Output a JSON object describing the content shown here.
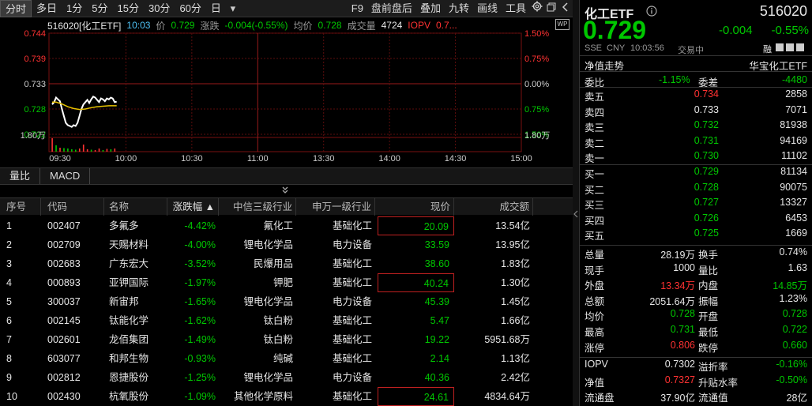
{
  "toolbar": {
    "timeframes": [
      "分时",
      "多日",
      "1分",
      "5分",
      "15分",
      "30分",
      "60分",
      "日"
    ],
    "dropdown_icon": "▾",
    "tools": [
      "F9",
      "盘前盘后",
      "叠加",
      "九转",
      "画线",
      "工具"
    ],
    "settings_icon": "gear-icon",
    "collapse_icon": "chevron-left-icon"
  },
  "chart_header": {
    "symbol": "516020[化工ETF]",
    "time": "10:03",
    "price_label": "价",
    "price": "0.729",
    "change_label": "涨跌",
    "change": "-0.004(-0.55%)",
    "avg_label": "均价",
    "avg": "0.728",
    "volume_label": "成交量",
    "volume": "4724",
    "iopv_label": "IOPV",
    "iopv": "0.7..."
  },
  "chart_data": {
    "type": "line",
    "y_ticks_left": [
      "0.744",
      "0.739",
      "0.733",
      "0.728",
      "0.722"
    ],
    "y_ticks_right": [
      "1.50%",
      "0.75%",
      "0.00%",
      "0.75%",
      "1.50%"
    ],
    "volume_tick_left": "1.80万",
    "volume_tick_right": "1.80万",
    "x_ticks": [
      "09:30",
      "10:00",
      "10:30",
      "11:00",
      "13:30",
      "14:00",
      "14:30",
      "15:00"
    ],
    "ylim": [
      0.722,
      0.744
    ],
    "prev_close": 0.733,
    "grid": true,
    "series": [
      {
        "name": "价",
        "color": "#ffffff",
        "points": [
          [
            0,
            0.7285
          ],
          [
            1,
            0.729
          ],
          [
            2,
            0.73
          ],
          [
            3,
            0.7296
          ],
          [
            4,
            0.7292
          ],
          [
            5,
            0.7275
          ],
          [
            6,
            0.726
          ],
          [
            7,
            0.7245
          ],
          [
            8,
            0.724
          ],
          [
            9,
            0.7238
          ],
          [
            10,
            0.7236
          ],
          [
            11,
            0.724
          ],
          [
            12,
            0.7238
          ],
          [
            13,
            0.7245
          ],
          [
            14,
            0.726
          ],
          [
            15,
            0.7275
          ],
          [
            16,
            0.7285
          ],
          [
            17,
            0.729
          ],
          [
            18,
            0.7295
          ],
          [
            19,
            0.7288
          ],
          [
            20,
            0.7296
          ],
          [
            21,
            0.7302
          ],
          [
            22,
            0.73
          ],
          [
            23,
            0.7295
          ],
          [
            24,
            0.729
          ],
          [
            25,
            0.7298
          ],
          [
            26,
            0.7296
          ],
          [
            27,
            0.7292
          ],
          [
            28,
            0.7298
          ],
          [
            29,
            0.7296
          ],
          [
            30,
            0.73
          ],
          [
            31,
            0.7298
          ],
          [
            32,
            0.729
          ],
          [
            33,
            0.7291
          ]
        ]
      },
      {
        "name": "均价",
        "color": "#e8c200",
        "points": [
          [
            0,
            0.729
          ],
          [
            2,
            0.729
          ],
          [
            5,
            0.7286
          ],
          [
            8,
            0.728
          ],
          [
            11,
            0.7276
          ],
          [
            14,
            0.7274
          ],
          [
            17,
            0.7275
          ],
          [
            20,
            0.7278
          ],
          [
            23,
            0.728
          ],
          [
            26,
            0.7281
          ],
          [
            29,
            0.7282
          ],
          [
            33,
            0.7282
          ]
        ]
      }
    ],
    "volume_bars": [
      {
        "x": 0,
        "v": 17000,
        "c": "red"
      },
      {
        "x": 2,
        "v": 8000,
        "c": "green"
      },
      {
        "x": 4,
        "v": 5000,
        "c": "red"
      },
      {
        "x": 6,
        "v": 4500,
        "c": "green"
      },
      {
        "x": 8,
        "v": 4000,
        "c": "green"
      },
      {
        "x": 10,
        "v": 3000,
        "c": "green"
      },
      {
        "x": 12,
        "v": 2500,
        "c": "green"
      },
      {
        "x": 14,
        "v": 4000,
        "c": "red"
      },
      {
        "x": 16,
        "v": 9000,
        "c": "red"
      },
      {
        "x": 18,
        "v": 3000,
        "c": "red"
      },
      {
        "x": 20,
        "v": 2500,
        "c": "green"
      },
      {
        "x": 22,
        "v": 2000,
        "c": "red"
      },
      {
        "x": 24,
        "v": 4000,
        "c": "red"
      },
      {
        "x": 26,
        "v": 2000,
        "c": "green"
      },
      {
        "x": 28,
        "v": 3500,
        "c": "red"
      },
      {
        "x": 30,
        "v": 3000,
        "c": "green"
      },
      {
        "x": 32,
        "v": 4000,
        "c": "red"
      }
    ]
  },
  "indicator_tabs": [
    "量比",
    "MACD"
  ],
  "expand_icon": "double-chevron-down-icon",
  "table": {
    "headers": [
      "序号",
      "代码",
      "名称",
      "涨跌幅 ▲",
      "中信三级行业",
      "申万一级行业",
      "现价",
      "成交额"
    ],
    "rows": [
      {
        "no": "1",
        "code": "002407",
        "name": "多氟多",
        "chg": "-4.42%",
        "citic": "氟化工",
        "sw": "基础化工",
        "price": "20.09",
        "amount": "13.54亿",
        "boxed": true
      },
      {
        "no": "2",
        "code": "002709",
        "name": "天赐材料",
        "chg": "-4.00%",
        "citic": "锂电化学品",
        "sw": "电力设备",
        "price": "33.59",
        "amount": "13.95亿",
        "boxed": false
      },
      {
        "no": "3",
        "code": "002683",
        "name": "广东宏大",
        "chg": "-3.52%",
        "citic": "民爆用品",
        "sw": "基础化工",
        "price": "38.60",
        "amount": "1.83亿",
        "boxed": false
      },
      {
        "no": "4",
        "code": "000893",
        "name": "亚钾国际",
        "chg": "-1.97%",
        "citic": "钾肥",
        "sw": "基础化工",
        "price": "40.24",
        "amount": "1.30亿",
        "boxed": true
      },
      {
        "no": "5",
        "code": "300037",
        "name": "新宙邦",
        "chg": "-1.65%",
        "citic": "锂电化学品",
        "sw": "电力设备",
        "price": "45.39",
        "amount": "1.45亿",
        "boxed": false
      },
      {
        "no": "6",
        "code": "002145",
        "name": "钛能化学",
        "chg": "-1.62%",
        "citic": "钛白粉",
        "sw": "基础化工",
        "price": "5.47",
        "amount": "1.66亿",
        "boxed": false
      },
      {
        "no": "7",
        "code": "002601",
        "name": "龙佰集团",
        "chg": "-1.49%",
        "citic": "钛白粉",
        "sw": "基础化工",
        "price": "19.22",
        "amount": "5951.68万",
        "boxed": false
      },
      {
        "no": "8",
        "code": "603077",
        "name": "和邦生物",
        "chg": "-0.93%",
        "citic": "纯碱",
        "sw": "基础化工",
        "price": "2.14",
        "amount": "1.13亿",
        "boxed": false
      },
      {
        "no": "9",
        "code": "002812",
        "name": "恩捷股份",
        "chg": "-1.25%",
        "citic": "锂电化学品",
        "sw": "电力设备",
        "price": "40.36",
        "amount": "2.42亿",
        "boxed": false
      },
      {
        "no": "10",
        "code": "002430",
        "name": "杭氧股份",
        "chg": "-1.09%",
        "citic": "其他化学原料",
        "sw": "基础化工",
        "price": "24.61",
        "amount": "4834.64万",
        "boxed": true
      }
    ]
  },
  "right": {
    "name": "化工ETF",
    "info_icon": "info-circle-icon",
    "code": "516020",
    "price": "0.729",
    "change": "-0.004",
    "change_pct": "-0.55%",
    "exchange": "SSE",
    "currency": "CNY",
    "time": "10:03:56",
    "status": "交易中",
    "nav_trend": "净值走势",
    "fund_name": "华宝化工ETF",
    "rong": "融",
    "weibi_label": "委比",
    "weibi": "-1.15%",
    "weicha_label": "委差",
    "weicha": "-4480",
    "asks": [
      {
        "label": "卖五",
        "price": "0.734",
        "vol": "2858",
        "color": "red"
      },
      {
        "label": "卖四",
        "price": "0.733",
        "vol": "7071",
        "color": "white"
      },
      {
        "label": "卖三",
        "price": "0.732",
        "vol": "81938",
        "color": "green"
      },
      {
        "label": "卖二",
        "price": "0.731",
        "vol": "94169",
        "color": "green"
      },
      {
        "label": "卖一",
        "price": "0.730",
        "vol": "11102",
        "color": "green"
      }
    ],
    "bids": [
      {
        "label": "买一",
        "price": "0.729",
        "vol": "81134",
        "color": "green"
      },
      {
        "label": "买二",
        "price": "0.728",
        "vol": "90075",
        "color": "green"
      },
      {
        "label": "买三",
        "price": "0.727",
        "vol": "13327",
        "color": "green"
      },
      {
        "label": "买四",
        "price": "0.726",
        "vol": "6453",
        "color": "green"
      },
      {
        "label": "买五",
        "price": "0.725",
        "vol": "1669",
        "color": "green"
      }
    ],
    "stats": [
      {
        "l1": "总量",
        "v1": "28.19万",
        "c1": "white",
        "l2": "换手",
        "v2": "0.74%",
        "c2": "white"
      },
      {
        "l1": "现手",
        "v1": "1000",
        "c1": "white",
        "l2": "量比",
        "v2": "1.63",
        "c2": "white"
      },
      {
        "l1": "外盘",
        "v1": "13.34万",
        "c1": "red",
        "l2": "内盘",
        "v2": "14.85万",
        "c2": "green"
      },
      {
        "l1": "总额",
        "v1": "2051.64万",
        "c1": "white",
        "l2": "振幅",
        "v2": "1.23%",
        "c2": "white"
      },
      {
        "l1": "均价",
        "v1": "0.728",
        "c1": "green",
        "l2": "开盘",
        "v2": "0.728",
        "c2": "green"
      },
      {
        "l1": "最高",
        "v1": "0.731",
        "c1": "green",
        "l2": "最低",
        "v2": "0.722",
        "c2": "green"
      },
      {
        "l1": "涨停",
        "v1": "0.806",
        "c1": "red",
        "l2": "跌停",
        "v2": "0.660",
        "c2": "green"
      }
    ],
    "stats2": [
      {
        "l1": "IOPV",
        "v1": "0.7302",
        "c1": "white",
        "l2": "溢折率",
        "v2": "-0.16%",
        "c2": "green"
      },
      {
        "l1": "净值",
        "v1": "0.7327",
        "c1": "red",
        "l2": "升贴水率",
        "v2": "-0.50%",
        "c2": "green"
      },
      {
        "l1": "流通盘",
        "v1": "37.90亿",
        "c1": "white",
        "l2": "流通值",
        "v2": "28亿",
        "c2": "white"
      }
    ]
  }
}
